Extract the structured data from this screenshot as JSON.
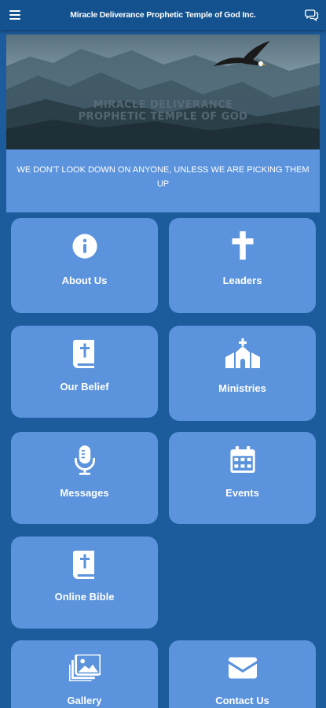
{
  "app_bar": {
    "title": "Miracle Deliverance Prophetic Temple of God Inc.",
    "menu_icon": "hamburger-menu-icon",
    "chat_icon": "chat-bubbles-icon"
  },
  "banner": {
    "line1": "MIRACLE DELIVERANCE",
    "line2": "PROPHETIC TEMPLE OF GOD"
  },
  "motto": "WE DON'T LOOK DOWN ON ANYONE, UNLESS WE ARE PICKING THEM UP",
  "tiles": [
    {
      "label": "About Us",
      "icon": "info-icon"
    },
    {
      "label": "Leaders",
      "icon": "cross-icon"
    },
    {
      "label": "Our Belief",
      "icon": "bible-icon"
    },
    {
      "label": "Ministries",
      "icon": "church-icon"
    },
    {
      "label": "Messages",
      "icon": "microphone-icon"
    },
    {
      "label": "Events",
      "icon": "calendar-icon"
    },
    {
      "label": "Online Bible",
      "icon": "bible-icon"
    },
    {
      "label": "Gallery",
      "icon": "gallery-icon"
    },
    {
      "label": "Contact Us",
      "icon": "envelope-icon"
    }
  ],
  "colors": {
    "background": "#1c5c9c",
    "app_bar": "#14528f",
    "tile": "#5b93dc"
  }
}
